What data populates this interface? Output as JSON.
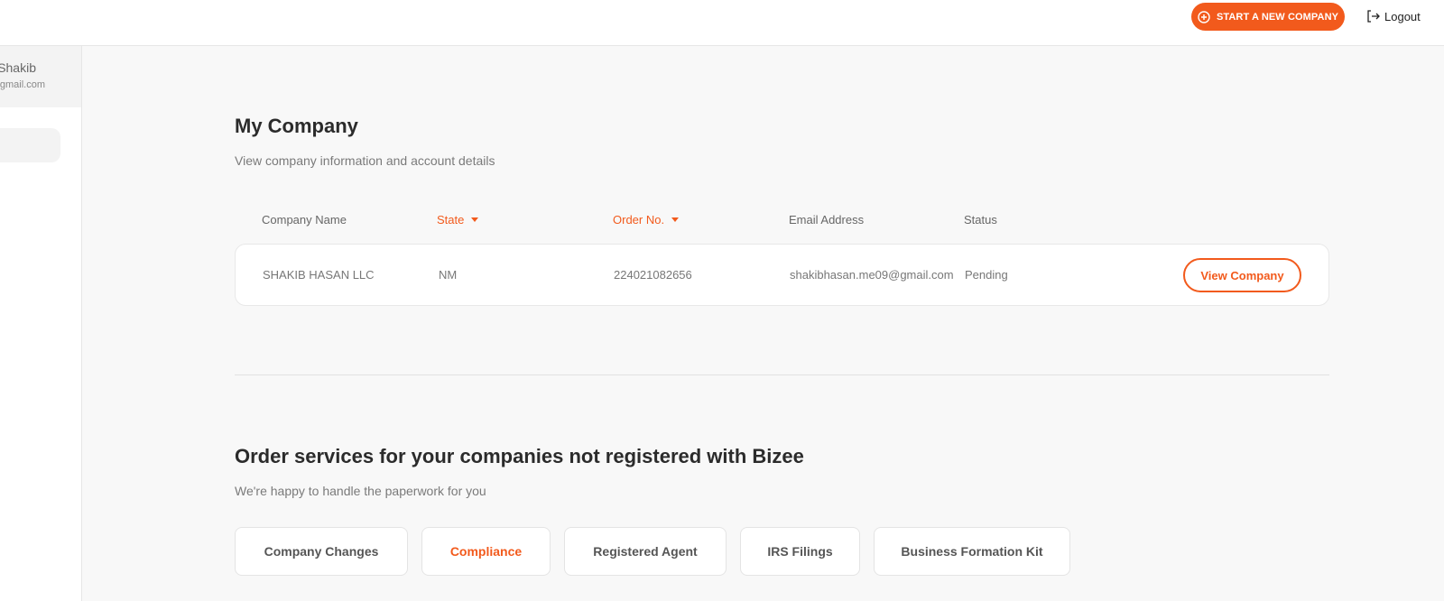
{
  "header": {
    "start_label": "START A NEW COMPANY",
    "logout_label": "Logout"
  },
  "sidebar": {
    "user_name": "Shakib",
    "user_email": "gmail.com"
  },
  "company_section": {
    "title": "My Company",
    "subtitle": "View company information and account details",
    "columns": [
      "Company Name",
      "State",
      "Order No.",
      "Email Address",
      "Status"
    ],
    "rows": [
      {
        "company_name": "SHAKIB HASAN LLC",
        "state": "NM",
        "order_no": "224021082656",
        "email": "shakibhasan.me09@gmail.com",
        "status": "Pending",
        "action_label": "View Company"
      }
    ]
  },
  "services_section": {
    "title": "Order services for your companies not registered with Bizee",
    "subtitle": "We're happy to handle the paperwork for you",
    "tabs": [
      {
        "label": "Company Changes"
      },
      {
        "label": "Compliance",
        "active": true
      },
      {
        "label": "Registered Agent"
      },
      {
        "label": "IRS Filings"
      },
      {
        "label": "Business Formation Kit"
      }
    ]
  },
  "colors": {
    "accent": "#f25a1c",
    "background": "#f8f8f8"
  }
}
